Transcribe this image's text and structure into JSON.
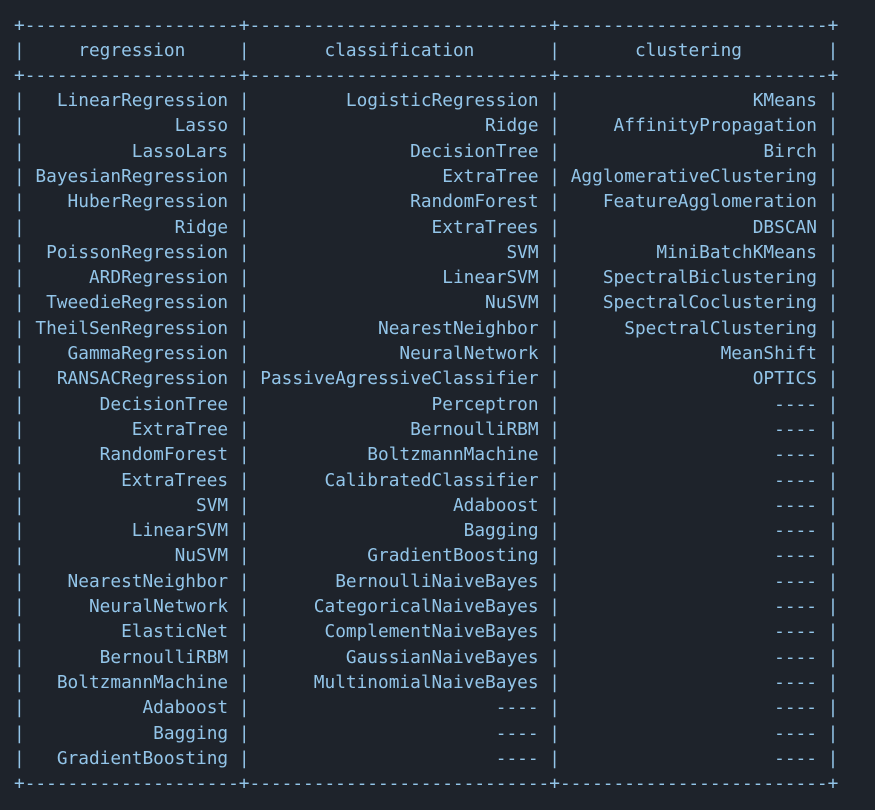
{
  "theme": {
    "background": "#1e232b",
    "text": "#93c5e9"
  },
  "table": {
    "headers": [
      "regression",
      "classification",
      "clustering"
    ],
    "rows": [
      [
        "LinearRegression",
        "LogisticRegression",
        "KMeans"
      ],
      [
        "Lasso",
        "Ridge",
        "AffinityPropagation"
      ],
      [
        "LassoLars",
        "DecisionTree",
        "Birch"
      ],
      [
        "BayesianRegression",
        "ExtraTree",
        "AgglomerativeClustering"
      ],
      [
        "HuberRegression",
        "RandomForest",
        "FeatureAgglomeration"
      ],
      [
        "Ridge",
        "ExtraTrees",
        "DBSCAN"
      ],
      [
        "PoissonRegression",
        "SVM",
        "MiniBatchKMeans"
      ],
      [
        "ARDRegression",
        "LinearSVM",
        "SpectralBiclustering"
      ],
      [
        "TweedieRegression",
        "NuSVM",
        "SpectralCoclustering"
      ],
      [
        "TheilSenRegression",
        "NearestNeighbor",
        "SpectralClustering"
      ],
      [
        "GammaRegression",
        "NeuralNetwork",
        "MeanShift"
      ],
      [
        "RANSACRegression",
        "PassiveAgressiveClassifier",
        "OPTICS"
      ],
      [
        "DecisionTree",
        "Perceptron",
        "----"
      ],
      [
        "ExtraTree",
        "BernoulliRBM",
        "----"
      ],
      [
        "RandomForest",
        "BoltzmannMachine",
        "----"
      ],
      [
        "ExtraTrees",
        "CalibratedClassifier",
        "----"
      ],
      [
        "SVM",
        "Adaboost",
        "----"
      ],
      [
        "LinearSVM",
        "Bagging",
        "----"
      ],
      [
        "NuSVM",
        "GradientBoosting",
        "----"
      ],
      [
        "NearestNeighbor",
        "BernoulliNaiveBayes",
        "----"
      ],
      [
        "NeuralNetwork",
        "CategoricalNaiveBayes",
        "----"
      ],
      [
        "ElasticNet",
        "ComplementNaiveBayes",
        "----"
      ],
      [
        "BernoulliRBM",
        "GaussianNaiveBayes",
        "----"
      ],
      [
        "BoltzmannMachine",
        "MultinomialNaiveBayes",
        "----"
      ],
      [
        "Adaboost",
        "----",
        "----"
      ],
      [
        "Bagging",
        "----",
        "----"
      ],
      [
        "GradientBoosting",
        "----",
        "----"
      ]
    ]
  }
}
